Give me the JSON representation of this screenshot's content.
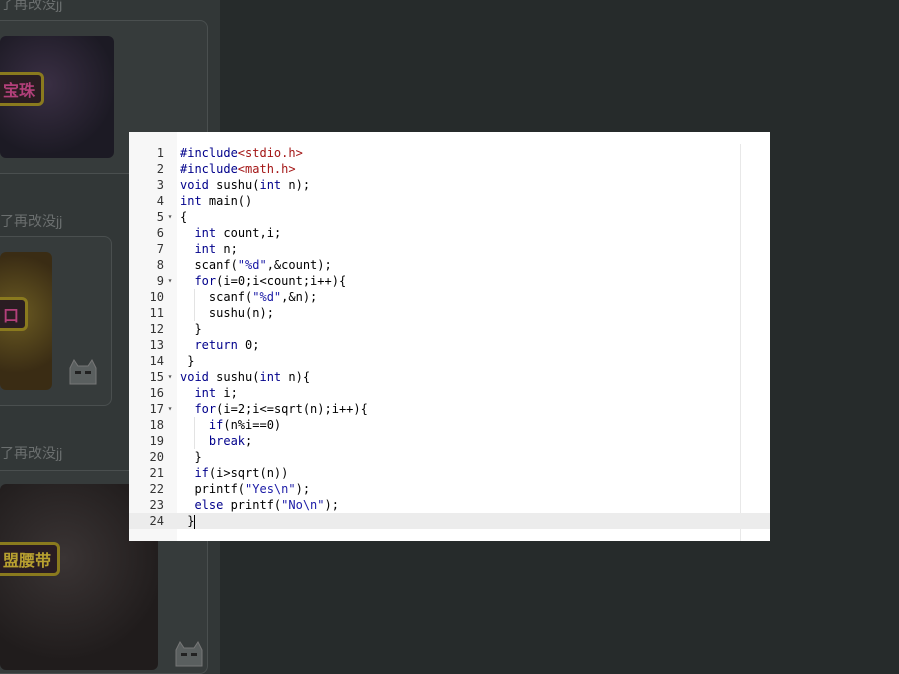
{
  "background": {
    "text_1": "了再改没jj",
    "text_2": "了再改没jj",
    "text_3": "了再改没jj",
    "badge_1": "宝珠",
    "badge_2": "口",
    "badge_3": "盟腰带"
  },
  "editor": {
    "lines": [
      {
        "n": "1",
        "fold": "",
        "text": "#include<stdio.h>"
      },
      {
        "n": "2",
        "fold": "",
        "text": "#include<math.h>"
      },
      {
        "n": "3",
        "fold": "",
        "text": "void sushu(int n);"
      },
      {
        "n": "4",
        "fold": "",
        "text": "int main()"
      },
      {
        "n": "5",
        "fold": "▾",
        "text": "{"
      },
      {
        "n": "6",
        "fold": "",
        "text": "  int count,i;"
      },
      {
        "n": "7",
        "fold": "",
        "text": "  int n;"
      },
      {
        "n": "8",
        "fold": "",
        "text": "  scanf(\"%d\",&count);"
      },
      {
        "n": "9",
        "fold": "▾",
        "text": "  for(i=0;i<count;i++){"
      },
      {
        "n": "10",
        "fold": "",
        "text": "    scanf(\"%d\",&n);"
      },
      {
        "n": "11",
        "fold": "",
        "text": "    sushu(n);"
      },
      {
        "n": "12",
        "fold": "",
        "text": "  }"
      },
      {
        "n": "13",
        "fold": "",
        "text": "  return 0;"
      },
      {
        "n": "14",
        "fold": "",
        "text": " }"
      },
      {
        "n": "15",
        "fold": "▾",
        "text": "void sushu(int n){"
      },
      {
        "n": "16",
        "fold": "",
        "text": "  int i;"
      },
      {
        "n": "17",
        "fold": "▾",
        "text": "  for(i=2;i<=sqrt(n);i++){"
      },
      {
        "n": "18",
        "fold": "",
        "text": "    if(n%i==0)"
      },
      {
        "n": "19",
        "fold": "",
        "text": "    break;"
      },
      {
        "n": "20",
        "fold": "",
        "text": "  }"
      },
      {
        "n": "21",
        "fold": "",
        "text": "  if(i>sqrt(n))"
      },
      {
        "n": "22",
        "fold": "",
        "text": "  printf(\"Yes\\n\");"
      },
      {
        "n": "23",
        "fold": "",
        "text": "  else printf(\"No\\n\");"
      },
      {
        "n": "24",
        "fold": "",
        "text": " }"
      }
    ],
    "active_line": "24"
  }
}
